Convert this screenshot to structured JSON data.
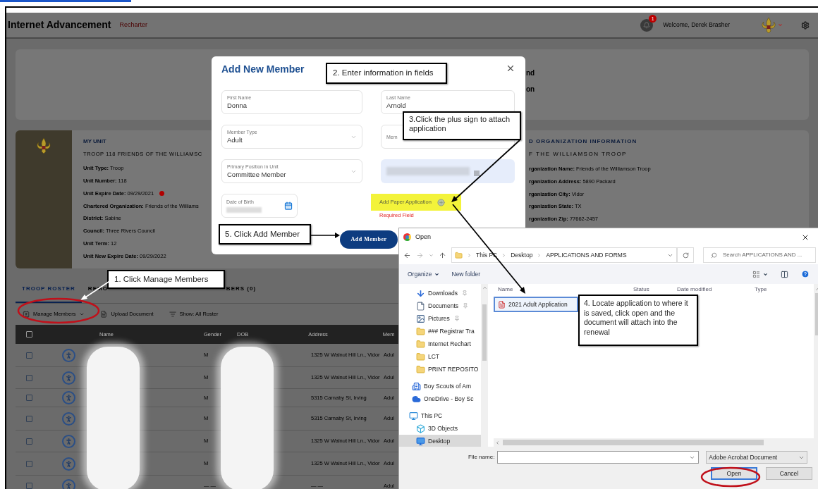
{
  "header": {
    "title": "Internet Advancement",
    "subtitle": "Recharter",
    "notification_count": "1",
    "welcome": "Welcome, Derek Brasher"
  },
  "summary_card": {
    "lines": [
      "nd",
      "on"
    ]
  },
  "unit": {
    "heading": "MY UNIT",
    "name": "TROOP 118 FRIENDS OF THE WILLIAMSC",
    "fields": [
      {
        "label": "Unit Type:",
        "value": "Troop",
        "alert": false
      },
      {
        "label": "Unit Number:",
        "value": "118",
        "alert": false
      },
      {
        "label": "Unit Expire Date:",
        "value": "09/29/2021",
        "alert": true
      },
      {
        "label": "Chartered Organization:",
        "value": "Friends of the Williams",
        "alert": false
      },
      {
        "label": "District:",
        "value": "Sabine",
        "alert": false
      },
      {
        "label": "Council:",
        "value": "Three Rivers Council",
        "alert": false
      },
      {
        "label": "Unit Term:",
        "value": "12",
        "alert": false
      },
      {
        "label": "Unit New Expire Date:",
        "value": "09/29/2022",
        "alert": false
      }
    ]
  },
  "organization": {
    "heading": "D ORGANIZATION INFORMATION",
    "name": "F THE WILLIAMSON TROOP",
    "fields": [
      {
        "label": "rganization Name:",
        "value": "Friends of the Williamson Troop"
      },
      {
        "label": "rganization Address:",
        "value": "5890 Packard"
      },
      {
        "label": "rganization City:",
        "value": "Vidor"
      },
      {
        "label": "rganization State:",
        "value": "TX"
      },
      {
        "label": "rganization Zip:",
        "value": "77662-2457"
      }
    ]
  },
  "tabs": [
    {
      "label": "TROOP ROSTER",
      "selected": true
    },
    {
      "label": "REMO",
      "selected": false
    },
    {
      "label": "BERS (0)",
      "selected": false
    }
  ],
  "toolbar": [
    {
      "kind": "menu",
      "label": "Manage Members",
      "circled": true
    },
    {
      "kind": "upload",
      "label": "Upload Document",
      "circled": false
    },
    {
      "kind": "filter",
      "label": "Show: All Roster",
      "circled": false
    }
  ],
  "table": {
    "all_checked": false,
    "columns": [
      "Name",
      "Gender",
      "DOB",
      "Address",
      "Mem"
    ],
    "rows": [
      {
        "checked": false,
        "gender": "M",
        "address": "1325 W Walnut Hill Ln., Vidor",
        "member": "Adul"
      },
      {
        "checked": false,
        "gender": "M",
        "address": "1325 W Walnut Hill Ln., Vidor",
        "member": "Adul"
      },
      {
        "checked": false,
        "gender": "M",
        "address": "5315 Carnaby St, Irving",
        "member": "Adul"
      },
      {
        "checked": false,
        "gender": "M",
        "address": "5315 Carnaby St, Irving",
        "member": "Adul"
      },
      {
        "checked": false,
        "gender": "M",
        "address": "1325 W Walnut Hill Ln., Vidor",
        "member": "Adul"
      },
      {
        "checked": false,
        "gender": "M",
        "address": "1325 W Walnut Hill Ln., Vidor",
        "member": "Adul"
      },
      {
        "checked": false,
        "gender": "— —",
        "address": "— —",
        "member": "Adul"
      }
    ]
  },
  "modal": {
    "title": "Add New Member",
    "fields": [
      {
        "kind": "text",
        "label": "First Name",
        "value": "Donna"
      },
      {
        "kind": "text",
        "label": "Last Name",
        "value": "Arnold"
      },
      {
        "kind": "select",
        "label": "Member Type",
        "value": "Adult"
      },
      {
        "kind": "text",
        "label": "Mem"
      },
      {
        "kind": "select",
        "label": "Primary Position in Unit",
        "value": "Committee Member"
      },
      {
        "kind": "blurred"
      }
    ],
    "date_label": "Date of Birth",
    "attachment": {
      "label": "Add Paper Application",
      "error": "Required Field",
      "highlighted": true
    },
    "submit": "Add Member"
  },
  "dialog": {
    "title": "Open",
    "path": [
      "This PC",
      "Desktop",
      "APPLICATIONS AND FORMS"
    ],
    "search_placeholder": "Search APPLICATIONS AND ...",
    "organize": "Organize",
    "new_folder": "New folder",
    "nav": [
      {
        "kind": "downloads",
        "label": "Downloads",
        "pinned": true,
        "selected": false
      },
      {
        "kind": "documents",
        "label": "Documents",
        "pinned": true,
        "selected": false
      },
      {
        "kind": "pictures",
        "label": "Pictures",
        "pinned": true,
        "selected": false
      },
      {
        "kind": "folder",
        "label": "### Registrar Tra",
        "pinned": false,
        "selected": false
      },
      {
        "kind": "folder",
        "label": "Internet Rechart",
        "pinned": false,
        "selected": false
      },
      {
        "kind": "folder",
        "label": "LCT",
        "pinned": false,
        "selected": false
      },
      {
        "kind": "folder",
        "label": "PRINT REPOSITO",
        "pinned": false,
        "selected": false
      },
      {
        "kind": "org",
        "label": "Boy Scouts of Am",
        "pinned": false,
        "selected": false
      },
      {
        "kind": "cloud",
        "label": "OneDrive - Boy Sc",
        "pinned": false,
        "selected": false
      },
      {
        "kind": "pc",
        "label": "This PC",
        "pinned": false,
        "selected": false
      },
      {
        "kind": "objects",
        "label": "3D Objects",
        "pinned": false,
        "selected": false
      },
      {
        "kind": "desktop",
        "label": "Desktop",
        "pinned": false,
        "selected": true
      }
    ],
    "columns": [
      "Name",
      "Status",
      "Date modified",
      "Type"
    ],
    "files": [
      {
        "name": "2021 Adult Application",
        "selected": true
      }
    ],
    "file_name_label": "File name:",
    "filter": "Adobe Acrobat Document",
    "open": "Open",
    "open_circled": true,
    "cancel": "Cancel"
  },
  "callouts": [
    "1. Click Manage Members",
    "2. Enter information in fields",
    "3.Click the plus sign to attach application",
    "4. Locate application to where it is saved, click open and the document will attach into the renewal",
    "5. Click Add Member"
  ]
}
